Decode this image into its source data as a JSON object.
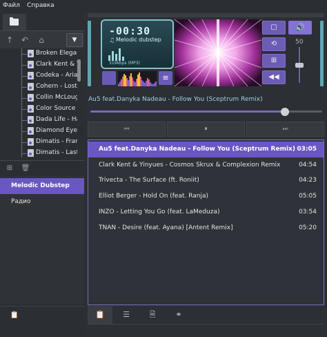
{
  "menu": {
    "file": "Файл",
    "help": "Справка"
  },
  "left_toolbar": {
    "up_icon": "arrow-up-icon",
    "undo_icon": "undo-icon",
    "home_icon": "home-icon",
    "dropdown_icon": "chevron-down-icon"
  },
  "tree": [
    "Broken Elegance",
    "Clark Kent & Yinyues",
    "Codeka - Ariadne",
    "Cohern - Lost",
    "Collin McLoughlin",
    "Color Source",
    "Dada Life - Happy",
    "Diamond Eyes",
    "Dimatis - Frames",
    "Dimatis - Last"
  ],
  "playlists": [
    {
      "name": "Melodic Dubstep",
      "active": true
    },
    {
      "name": "Радио",
      "active": false
    }
  ],
  "lcd": {
    "time": "-00:30",
    "title": "Melodic dubstep",
    "rate": "319kbps (MP3)"
  },
  "volume": {
    "value": "50",
    "level": 0.5
  },
  "now_playing": "Au5 feat.Danyka Nadeau - Follow You (Sceptrum Remix)",
  "progress": 0.84,
  "transport": {
    "prev": "⏮",
    "pause": "⏸",
    "next": "⏭"
  },
  "tracks": [
    {
      "title": "Au5 feat.Danyka Nadeau - Follow You (Sceptrum Remix)",
      "duration": "03:05",
      "active": true
    },
    {
      "title": "Clark Kent & Yinyues - Cosmos  Skrux & Complexion Remix",
      "duration": "04:54",
      "active": false
    },
    {
      "title": "Trivecta - The Surface (ft. Roniit)",
      "duration": "04:23",
      "active": false
    },
    {
      "title": "Elliot Berger - Hold On (feat. Ranja)",
      "duration": "05:05",
      "active": false
    },
    {
      "title": "INZO - Letting You Go (feat. LaMeduza)",
      "duration": "03:54",
      "active": false
    },
    {
      "title": "TNAN - Desire (feat. Ayana) [Antent Remix]",
      "duration": "05:20",
      "active": false
    }
  ],
  "colors": {
    "accent": "#6b57c4",
    "lcd_border": "#86c3cc",
    "side_bar": "#5fa6b2"
  }
}
